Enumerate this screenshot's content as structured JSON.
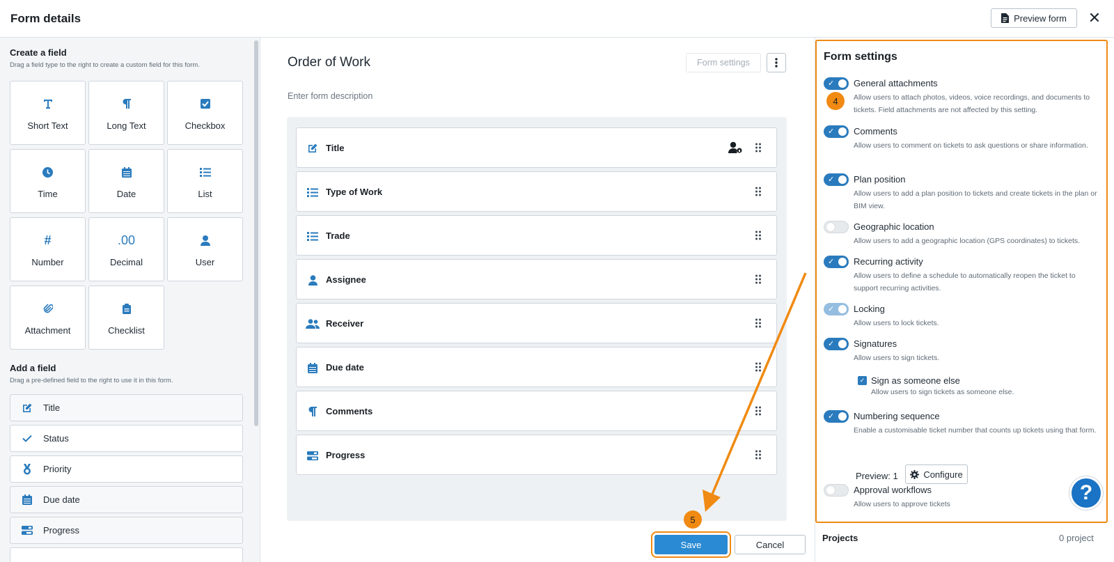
{
  "header": {
    "title": "Form details",
    "preview_label": "Preview form",
    "close_glyph": "✕"
  },
  "left": {
    "create_title": "Create a field",
    "create_sub": "Drag a field type to the right to create a custom field for this form.",
    "field_types": [
      {
        "label": "Short Text",
        "icon": "text-icon"
      },
      {
        "label": "Long Text",
        "icon": "paragraph-icon"
      },
      {
        "label": "Checkbox",
        "icon": "checkbox-icon"
      },
      {
        "label": "Time",
        "icon": "clock-icon"
      },
      {
        "label": "Date",
        "icon": "calendar-icon"
      },
      {
        "label": "List",
        "icon": "list-icon"
      },
      {
        "label": "Number",
        "icon": "hash-icon"
      },
      {
        "label": "Decimal",
        "icon": "decimal-icon"
      },
      {
        "label": "User",
        "icon": "user-icon"
      },
      {
        "label": "Attachment",
        "icon": "paperclip-icon"
      },
      {
        "label": "Checklist",
        "icon": "clipboard-icon"
      }
    ],
    "add_title": "Add a field",
    "add_sub": "Drag a pre-defined field to the right to use it in this form.",
    "predefined": [
      {
        "label": "Title",
        "icon": "edit-icon"
      },
      {
        "label": "Status",
        "icon": "check-icon"
      },
      {
        "label": "Priority",
        "icon": "medal-icon"
      },
      {
        "label": "Due date",
        "icon": "calendar-icon"
      },
      {
        "label": "Progress",
        "icon": "progress-icon"
      }
    ]
  },
  "main": {
    "form_name": "Order of Work",
    "form_settings_label": "Form settings",
    "description_placeholder": "Enter form description",
    "fields": [
      {
        "label": "Title",
        "icon": "edit-icon"
      },
      {
        "label": "Type of Work",
        "icon": "list-icon"
      },
      {
        "label": "Trade",
        "icon": "list-icon"
      },
      {
        "label": "Assignee",
        "icon": "user-icon"
      },
      {
        "label": "Receiver",
        "icon": "users-icon"
      },
      {
        "label": "Due date",
        "icon": "calendar-icon"
      },
      {
        "label": "Comments",
        "icon": "paragraph-icon"
      },
      {
        "label": "Progress",
        "icon": "progress-icon"
      }
    ],
    "save_label": "Save",
    "cancel_label": "Cancel"
  },
  "settings": {
    "title": "Form settings",
    "items": [
      {
        "name": "General attachments",
        "desc": "Allow users to attach photos, videos, voice recordings, and documents to tickets. Field attachments are not affected by this setting.",
        "state": "on"
      },
      {
        "name": "Comments",
        "desc": "Allow users to comment on tickets to ask questions or share information.",
        "state": "on"
      },
      {
        "name": "Plan position",
        "desc": "Allow users to add a plan position to tickets and create tickets in the plan or BIM view.",
        "state": "on"
      },
      {
        "name": "Geographic location",
        "desc": "Allow users to add a geographic location (GPS coordinates) to tickets.",
        "state": "off"
      },
      {
        "name": "Recurring activity",
        "desc": "Allow users to define a schedule to automatically reopen the ticket to support recurring activities.",
        "state": "on"
      },
      {
        "name": "Locking",
        "desc": "Allow users to lock tickets.",
        "state": "disabled-on"
      },
      {
        "name": "Signatures",
        "desc": "Allow users to sign tickets.",
        "state": "on"
      },
      {
        "name": "Numbering sequence",
        "desc": "Enable a customisable ticket number that counts up tickets using that form.",
        "state": "on"
      },
      {
        "name": "Approval workflows",
        "desc": "Allow users to approve tickets",
        "state": "off"
      }
    ],
    "sub_setting": {
      "name": "Sign as someone else",
      "desc": "Allow users to sign tickets as someone else.",
      "checked": true
    },
    "preview_label": "Preview: 1",
    "configure_label": "Configure",
    "help_glyph": "?",
    "projects_label": "Projects",
    "projects_count": "0 project"
  },
  "annotations": {
    "step4": "4",
    "step5": "5",
    "accent_color": "#f08a12"
  },
  "colors": {
    "brand_blue": "#2a7bbd",
    "save_blue": "#2a8ad3"
  }
}
